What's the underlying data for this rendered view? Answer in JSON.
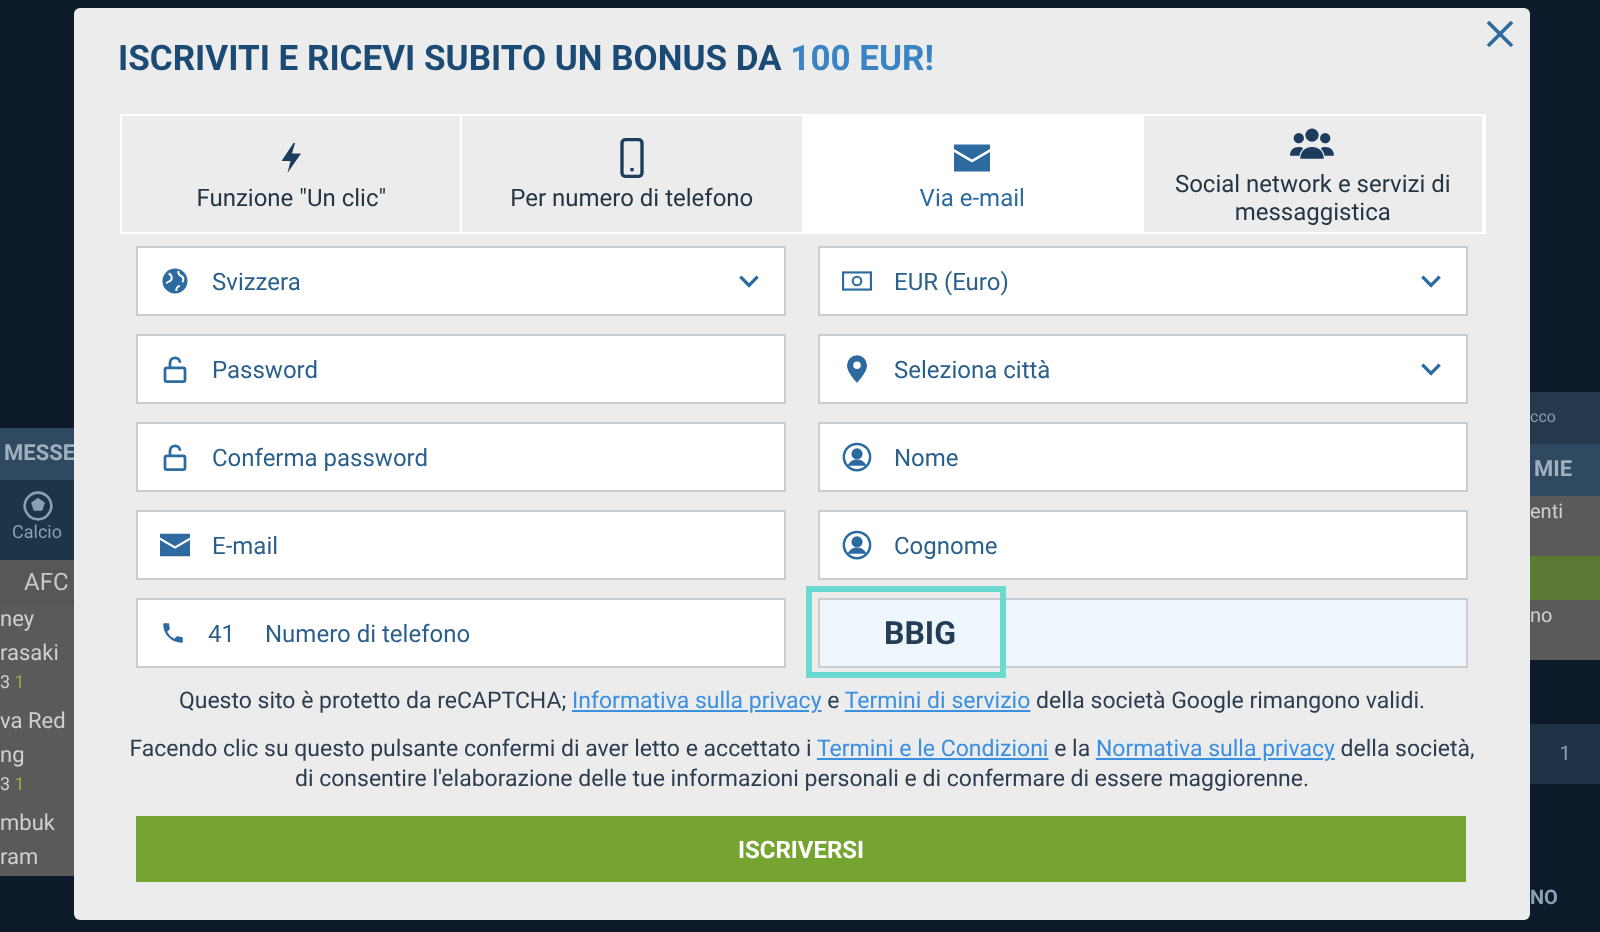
{
  "background": {
    "left_items": [
      {
        "kind": "header",
        "text": "MESSE"
      },
      {
        "kind": "sport",
        "text": "Calcio"
      },
      {
        "kind": "league",
        "text": "AFC"
      },
      {
        "kind": "team",
        "text": "ney"
      },
      {
        "kind": "team",
        "text": "rasaki"
      },
      {
        "kind": "time",
        "text": "3",
        "sub": "1"
      },
      {
        "kind": "team",
        "text": "va Red"
      },
      {
        "kind": "team",
        "text": "ng"
      },
      {
        "kind": "time",
        "text": "3",
        "sub": "1"
      },
      {
        "kind": "team",
        "text": "mbuk"
      },
      {
        "kind": "team",
        "text": "ram"
      }
    ],
    "right_items": [
      {
        "kind": "small",
        "text": "cco"
      },
      {
        "kind": "header",
        "text": "MIE"
      },
      {
        "kind": "note",
        "text": "enti"
      },
      {
        "kind": "bar"
      },
      {
        "kind": "note",
        "text": "no"
      },
      {
        "kind": "page",
        "text": "1"
      },
      {
        "kind": "footer",
        "text": "NO"
      }
    ]
  },
  "modal": {
    "title": "ISCRIVITI E RICEVI SUBITO UN BONUS DA ",
    "title_highlight": "100 EUR!",
    "tabs": [
      {
        "label": "Funzione \"Un clic\"",
        "selected": false
      },
      {
        "label": "Per numero di telefono",
        "selected": false
      },
      {
        "label": "Via e-mail",
        "selected": true
      },
      {
        "label": "Social network e servizi di messaggistica",
        "selected": false
      }
    ],
    "fields_left": [
      {
        "kind": "select",
        "value": "Svizzera"
      },
      {
        "kind": "input",
        "placeholder": "Password"
      },
      {
        "kind": "input",
        "placeholder": "Conferma password"
      },
      {
        "kind": "input",
        "placeholder": "E-mail"
      },
      {
        "kind": "phone",
        "code": "41",
        "placeholder": "Numero di telefono"
      }
    ],
    "fields_right": [
      {
        "kind": "select",
        "value": "EUR (Euro)"
      },
      {
        "kind": "select",
        "value": "Seleziona città"
      },
      {
        "kind": "input",
        "placeholder": "Nome"
      },
      {
        "kind": "input",
        "placeholder": "Cognome"
      },
      {
        "kind": "captcha",
        "value": "BBIG"
      }
    ],
    "recaptcha_note": {
      "before": "Questo sito è protetto da reCAPTCHA; ",
      "link1": "Informativa sulla privacy",
      "middle": " e ",
      "link2": "Termini di servizio",
      "after": " della società Google rimangono validi."
    },
    "consent_note": {
      "before": "Facendo clic su questo pulsante confermi di aver letto e accettato i ",
      "link1": "Termini e le Condizioni",
      "middle": " e la ",
      "link2": "Normativa sulla privacy",
      "after": " della società, di consentire l'elaborazione delle tue informazioni personali e di confermare di essere maggiorenne."
    },
    "submit": "ISCRIVERSI"
  }
}
